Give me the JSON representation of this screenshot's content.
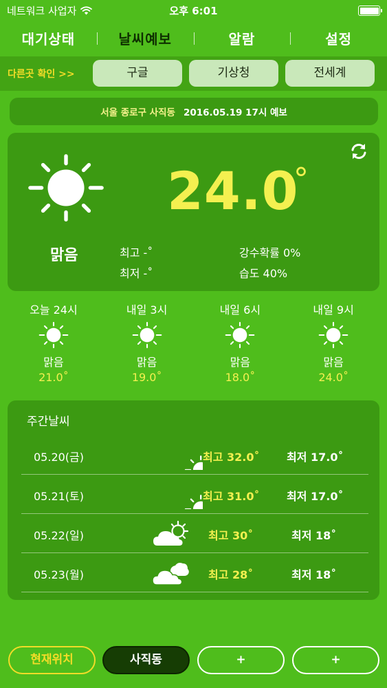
{
  "status_bar": {
    "carrier": "네트워크 사업자",
    "time": "오후 6:01",
    "battery_level": 1.0
  },
  "tabs": [
    {
      "label": "대기상태",
      "active": false
    },
    {
      "label": "날씨예보",
      "active": true
    },
    {
      "label": "알람",
      "active": false
    },
    {
      "label": "설정",
      "active": false
    }
  ],
  "other_sources": {
    "label": "다른곳 확인 >>",
    "buttons": [
      "구글",
      "기상청",
      "전세계"
    ]
  },
  "location": {
    "place": "서울 종로구 사직동",
    "forecast_time": "2016.05.19 17시 예보"
  },
  "current": {
    "temp": "24.0",
    "degree": "°",
    "condition": "맑음",
    "max": "최고 -˚",
    "min": "최저 -˚",
    "rain_prob": "강수확률 0%",
    "humidity": "습도 40%",
    "icon": "sun-icon",
    "refresh_icon": "refresh-icon"
  },
  "hourly": [
    {
      "time": "오늘 24시",
      "icon": "sun-icon",
      "condition": "맑음",
      "temp": "21.0˚"
    },
    {
      "time": "내일 3시",
      "icon": "sun-icon",
      "condition": "맑음",
      "temp": "19.0˚"
    },
    {
      "time": "내일 6시",
      "icon": "sun-icon",
      "condition": "맑음",
      "temp": "18.0˚"
    },
    {
      "time": "내일 9시",
      "icon": "sun-icon",
      "condition": "맑음",
      "temp": "24.0˚"
    }
  ],
  "weekly": {
    "title": "주간날씨",
    "days": [
      {
        "date": "05.20(금)",
        "icon": "sun-icon",
        "max": "최고 32.0˚",
        "min": "최저 17.0˚"
      },
      {
        "date": "05.21(토)",
        "icon": "sun-icon",
        "max": "최고 31.0˚",
        "min": "최저 17.0˚"
      },
      {
        "date": "05.22(일)",
        "icon": "sun-cloud-icon",
        "max": "최고 30˚",
        "min": "최저 18˚"
      },
      {
        "date": "05.23(월)",
        "icon": "cloudy-icon",
        "max": "최고 28˚",
        "min": "최저 18˚"
      }
    ]
  },
  "bottom_buttons": [
    "현재위치",
    "사직동",
    "+",
    "+"
  ],
  "colors": {
    "background": "#4fbd1c",
    "panel": "#3c9a12",
    "accent_yellow": "#f4f050",
    "label_yellow": "#f2dc28",
    "selected_button": "#163d04"
  }
}
